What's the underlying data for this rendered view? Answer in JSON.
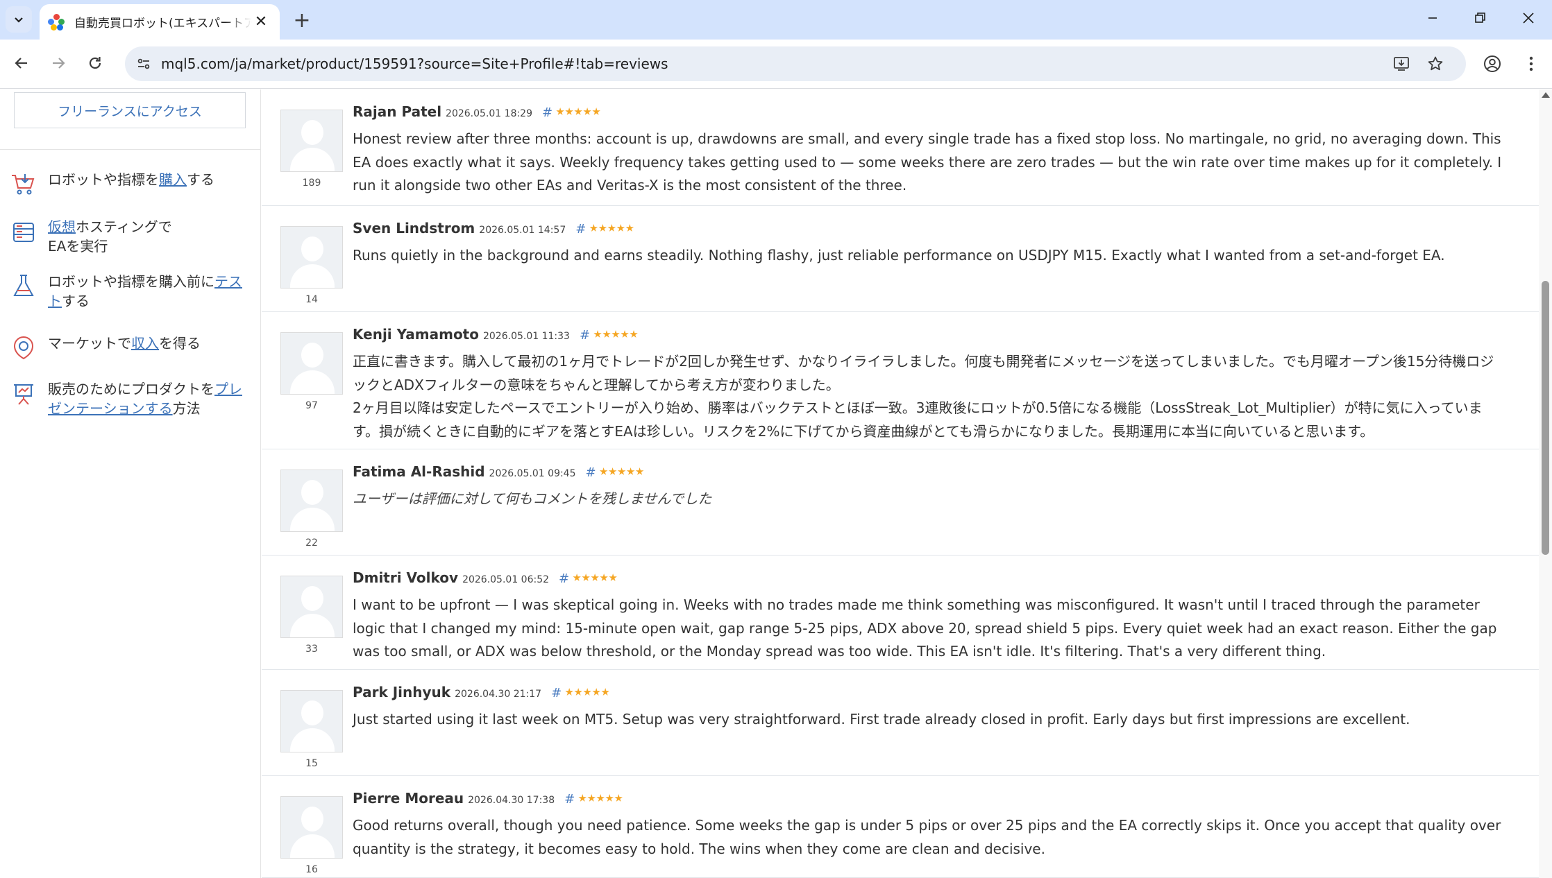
{
  "browser": {
    "tab_title": "自動売買ロボット(エキスパートアドバイザー)",
    "url": "mql5.com/ja/market/product/159591?source=Site+Profile#!tab=reviews"
  },
  "sidebar": {
    "freelance_button": "フリーランスにアクセス",
    "items": [
      {
        "icon": "cart-icon",
        "before": "ロボットや指標を",
        "link": "購入",
        "after": "する"
      },
      {
        "icon": "server-icon",
        "before": "",
        "link": "仮想",
        "after": "ホスティングで EAを実行"
      },
      {
        "icon": "flask-icon",
        "before": "ロボットや指標を購入前に",
        "link": "テスト",
        "after": "する"
      },
      {
        "icon": "money-bag-icon",
        "before": "マーケットで",
        "link": "収入",
        "after": "を得る"
      },
      {
        "icon": "presentation-icon",
        "before": "販売のためにプロダクトを",
        "link": "プレゼンテーションする",
        "after": "方法"
      }
    ]
  },
  "reviews": [
    {
      "name": "Rajan Patel",
      "date": "2026.05.01 18:29",
      "hash": "#",
      "stars": 5,
      "rating_count": "189",
      "paragraphs": [
        "Honest review after three months: account is up, drawdowns are small, and every single trade has a fixed stop loss. No martingale, no grid, no averaging down. This EA does exactly what it says. Weekly frequency takes getting used to — some weeks there are zero trades — but the win rate over time makes up for it completely. I run it alongside two other EAs and Veritas-X is the most consistent of the three."
      ],
      "italic": false
    },
    {
      "name": "Sven Lindstrom",
      "date": "2026.05.01 14:57",
      "hash": "#",
      "stars": 5,
      "rating_count": "14",
      "paragraphs": [
        "Runs quietly in the background and earns steadily. Nothing flashy, just reliable performance on USDJPY M15. Exactly what I wanted from a set-and-forget EA."
      ],
      "italic": false
    },
    {
      "name": "Kenji Yamamoto",
      "date": "2026.05.01 11:33",
      "hash": "#",
      "stars": 5,
      "rating_count": "97",
      "paragraphs": [
        "正直に書きます。購入して最初の1ヶ月でトレードが2回しか発生せず、かなりイライラしました。何度も開発者にメッセージを送ってしまいました。でも月曜オープン後15分待機ロジックとADXフィルターの意味をちゃんと理解してから考え方が変わりました。",
        "2ヶ月目以降は安定したペースでエントリーが入り始め、勝率はバックテストとほぼ一致。3連敗後にロットが0.5倍になる機能（LossStreak_Lot_Multiplier）が特に気に入っています。損が続くときに自動的にギアを落とすEAは珍しい。リスクを2%に下げてから資産曲線がとても滑らかになりました。長期運用に本当に向いていると思います。"
      ],
      "italic": false
    },
    {
      "name": "Fatima Al-Rashid",
      "date": "2026.05.01 09:45",
      "hash": "#",
      "stars": 5,
      "rating_count": "22",
      "paragraphs": [
        "ユーザーは評価に対して何もコメントを残しませんでした"
      ],
      "italic": true
    },
    {
      "name": "Dmitri Volkov",
      "date": "2026.05.01 06:52",
      "hash": "#",
      "stars": 5,
      "rating_count": "33",
      "paragraphs": [
        "I want to be upfront — I was skeptical going in. Weeks with no trades made me think something was misconfigured. It wasn't until I traced through the parameter logic that I changed my mind: 15-minute open wait, gap range 5-25 pips, ADX above 20, spread shield 5 pips. Every quiet week had an exact reason. Either the gap was too small, or ADX was below threshold, or the Monday spread was too wide. This EA isn't idle. It's filtering. That's a very different thing."
      ],
      "italic": false
    },
    {
      "name": "Park Jinhyuk",
      "date": "2026.04.30 21:17",
      "hash": "#",
      "stars": 5,
      "rating_count": "15",
      "paragraphs": [
        "Just started using it last week on MT5. Setup was very straightforward. First trade already closed in profit. Early days but first impressions are excellent."
      ],
      "italic": false
    },
    {
      "name": "Pierre Moreau",
      "date": "2026.04.30 17:38",
      "hash": "#",
      "stars": 5,
      "rating_count": "16",
      "paragraphs": [
        "Good returns overall, though you need patience. Some weeks the gap is under 5 pips or over 25 pips and the EA correctly skips it. Once you accept that quality over quantity is the strategy, it becomes easy to hold. The wins when they come are clean and decisive."
      ],
      "italic": false
    }
  ],
  "colors": {
    "accent": "#3c72b8",
    "star": "#f5a623",
    "tabstrip": "#d3e3fd"
  }
}
